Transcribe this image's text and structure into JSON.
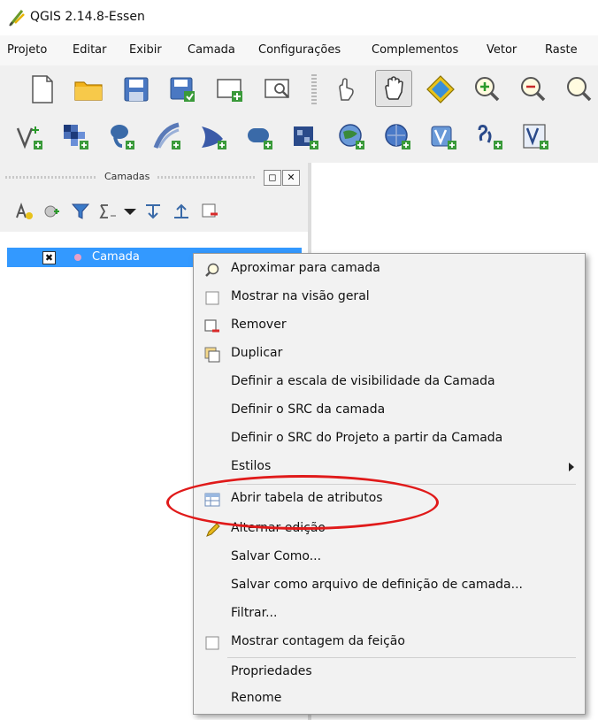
{
  "window": {
    "title": "QGIS 2.14.8-Essen"
  },
  "menu": [
    "Projeto",
    "Editar",
    "Exibir",
    "Camada",
    "Configurações",
    "Complementos",
    "Vetor",
    "Raste"
  ],
  "toolbar1_icons": [
    "new-project-icon",
    "open-project-icon",
    "save-project-icon",
    "save-as-icon",
    "new-print-composer-icon",
    "composer-manager-icon",
    "touch-zoom-icon",
    "pan-icon",
    "pan-to-selection-icon",
    "zoom-in-icon",
    "zoom-out-icon",
    "zoom-icon"
  ],
  "toolbar2_icons": [
    "add-vector-layer-icon",
    "add-raster-layer-icon",
    "add-postgis-layer-icon",
    "add-spatialite-layer-icon",
    "add-mssql-layer-icon",
    "add-oracle-layer-icon",
    "add-db2-layer-icon",
    "add-wms-layer-icon",
    "add-wcs-layer-icon",
    "add-wfs-layer-icon",
    "add-delimited-text-icon",
    "add-virtual-layer-icon"
  ],
  "layers_panel": {
    "title": "Camadas",
    "layer": {
      "name": "Camada",
      "checked_mark": "✖"
    }
  },
  "context_menu": {
    "items": [
      {
        "label": "Aproximar para camada",
        "icon": "zoom-to-layer-icon"
      },
      {
        "label": "Mostrar na visão geral",
        "icon": "checkbox-icon"
      },
      {
        "label": "Remover",
        "icon": "remove-layer-icon"
      },
      {
        "label": "Duplicar",
        "icon": "duplicate-layer-icon"
      },
      {
        "label": "Definir a escala de visibilidade da Camada",
        "icon": ""
      },
      {
        "label": "Definir o SRC da camada",
        "icon": ""
      },
      {
        "label": "Definir o SRC do Projeto a partir da Camada",
        "icon": ""
      },
      {
        "label": "Estilos",
        "icon": "",
        "submenu": true
      },
      {
        "label": "Abrir tabela de atributos",
        "icon": "attribute-table-icon"
      },
      {
        "label": "Alternar edição",
        "icon": "pencil-icon"
      },
      {
        "label": "Salvar Como...",
        "icon": ""
      },
      {
        "label": "Salvar como arquivo de definição de camada...",
        "icon": ""
      },
      {
        "label": "Filtrar...",
        "icon": ""
      },
      {
        "label": "Mostrar contagem da feição",
        "icon": "checkbox-icon"
      },
      {
        "label": "Propriedades",
        "icon": ""
      },
      {
        "label": "Renome",
        "icon": ""
      }
    ]
  },
  "colors": {
    "selection": "#3399ff",
    "highlight_ellipse": "#e01a1a"
  }
}
